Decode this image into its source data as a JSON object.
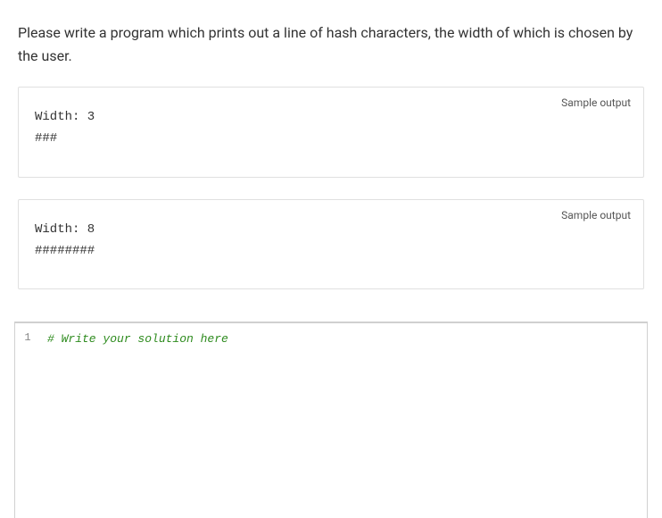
{
  "problem": {
    "statement": "Please write a program which prints out a line of hash characters, the width of which is chosen by the user."
  },
  "samples": [
    {
      "label": "Sample output",
      "lines": [
        "Width: 3",
        "###"
      ]
    },
    {
      "label": "Sample output",
      "lines": [
        "Width: 8",
        "########"
      ]
    }
  ],
  "editor": {
    "lines": [
      {
        "number": "1",
        "text": "# Write your solution here"
      }
    ]
  }
}
